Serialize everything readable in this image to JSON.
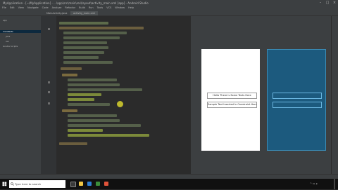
{
  "window": {
    "title": "MyApplication - [~/MyApplication] - ...\\app\\src\\main\\res\\layout\\activity_main.xml [app] - Android Studio"
  },
  "menu": [
    "File",
    "Edit",
    "View",
    "Navigate",
    "Code",
    "Analyze",
    "Refactor",
    "Build",
    "Run",
    "Tools",
    "VCS",
    "Window",
    "Help"
  ],
  "tabs": [
    "MainActivity.java",
    "activity_main.xml"
  ],
  "project": {
    "items": [
      "app",
      "manifests",
      "java",
      "res",
      "Gradle Scripts"
    ]
  },
  "preview": {
    "textview1": "Hello There is Some Texts Here",
    "textview2": "Sample Text Inserted In Constraint Here"
  },
  "taskbar": {
    "search_placeholder": "Type here to search"
  },
  "colors": {
    "editor_bg": "#2b2b2b",
    "panel_bg": "#3c3f41",
    "blueprint": "#1c5a7e",
    "highlight": "#8a8f3a",
    "xml_string": "#6a8759",
    "xml_attr": "#bababa",
    "xml_tag": "#e8bf6a"
  }
}
